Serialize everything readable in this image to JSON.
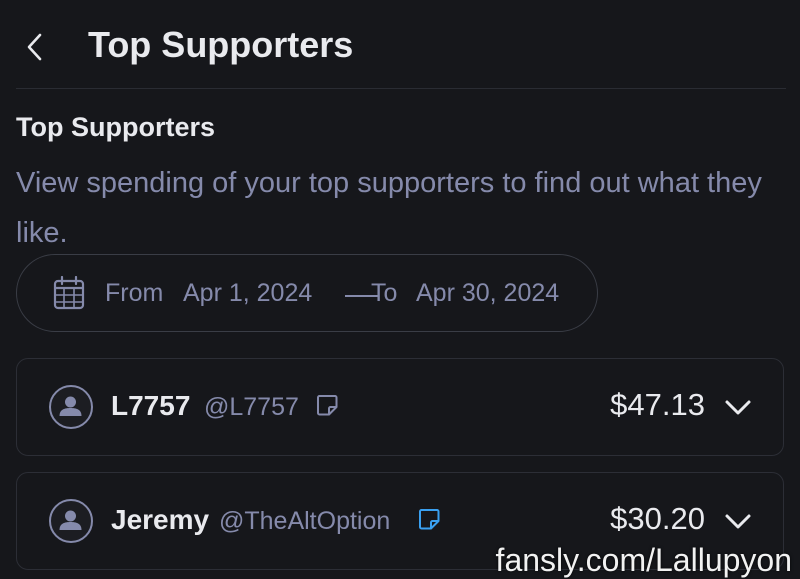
{
  "header": {
    "title": "Top Supporters",
    "back_icon": "chevron-left-icon"
  },
  "section": {
    "title": "Top Supporters",
    "description": "View spending of your top supporters to find out what they like."
  },
  "date_range": {
    "icon": "calendar-icon",
    "from_label": "From",
    "from_date": "Apr 1, 2024",
    "to_label": "To",
    "to_date": "Apr 30, 2024"
  },
  "supporters": [
    {
      "display_name": "L7757",
      "handle": "@L7757",
      "amount": "$47.13",
      "note_icon_color": "#858aab"
    },
    {
      "display_name": "Jeremy",
      "handle": "@TheAltOption",
      "amount": "$30.20",
      "note_icon_color": "#3aa0f0"
    }
  ],
  "watermark": "fansly.com/Lallupyon",
  "colors": {
    "background": "#16171b",
    "text_primary": "#e9eaee",
    "text_muted": "#858aab",
    "border": "#2c2e36",
    "accent": "#3aa0f0"
  }
}
